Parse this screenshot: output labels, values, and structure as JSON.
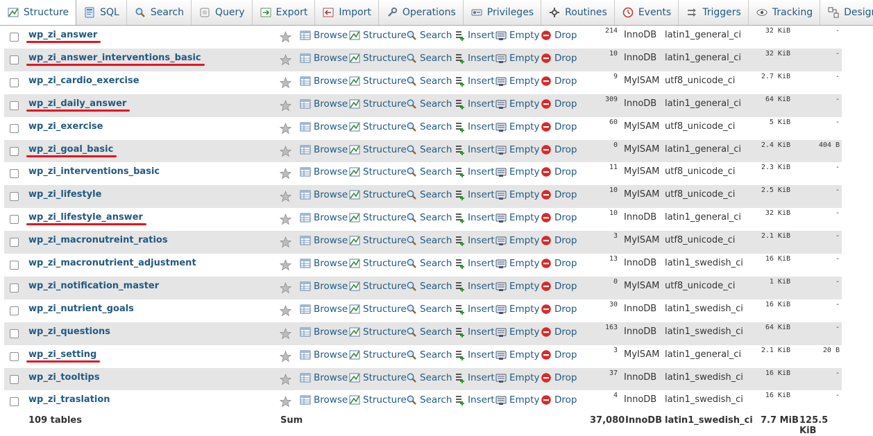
{
  "tabs": [
    {
      "label": "Structure",
      "icon": "structure-icon",
      "active": true
    },
    {
      "label": "SQL",
      "icon": "sql-icon",
      "active": false
    },
    {
      "label": "Search",
      "icon": "search-icon",
      "active": false
    },
    {
      "label": "Query",
      "icon": "query-icon",
      "active": false
    },
    {
      "label": "Export",
      "icon": "export-icon",
      "active": false
    },
    {
      "label": "Import",
      "icon": "import-icon",
      "active": false
    },
    {
      "label": "Operations",
      "icon": "wrench-icon",
      "active": false
    },
    {
      "label": "Privileges",
      "icon": "privileges-icon",
      "active": false
    },
    {
      "label": "Routines",
      "icon": "routines-icon",
      "active": false
    },
    {
      "label": "Events",
      "icon": "clock-icon",
      "active": false
    },
    {
      "label": "Triggers",
      "icon": "triggers-icon",
      "active": false
    },
    {
      "label": "Tracking",
      "icon": "eye-icon",
      "active": false
    },
    {
      "label": "Designer",
      "icon": "designer-icon",
      "active": false
    }
  ],
  "actions": {
    "browse": "Browse",
    "structure": "Structure",
    "search": "Search",
    "insert": "Insert",
    "empty": "Empty",
    "drop": "Drop"
  },
  "tables": [
    {
      "name": "wp_zi_answer",
      "rows": "214",
      "engine": "InnoDB",
      "collation": "latin1_general_ci",
      "size": "32 KiB",
      "overhead": "-",
      "underlined": true
    },
    {
      "name": "wp_zi_answer_interventions_basic",
      "rows": "10",
      "engine": "InnoDB",
      "collation": "latin1_general_ci",
      "size": "32 KiB",
      "overhead": "-",
      "underlined": true
    },
    {
      "name": "wp_zi_cardio_exercise",
      "rows": "9",
      "engine": "MyISAM",
      "collation": "utf8_unicode_ci",
      "size": "2.7 KiB",
      "overhead": "-",
      "underlined": false
    },
    {
      "name": "wp_zi_daily_answer",
      "rows": "309",
      "engine": "InnoDB",
      "collation": "latin1_general_ci",
      "size": "64 KiB",
      "overhead": "-",
      "underlined": true
    },
    {
      "name": "wp_zi_exercise",
      "rows": "60",
      "engine": "MyISAM",
      "collation": "utf8_unicode_ci",
      "size": "5 KiB",
      "overhead": "-",
      "underlined": false
    },
    {
      "name": "wp_zi_goal_basic",
      "rows": "0",
      "engine": "MyISAM",
      "collation": "latin1_general_ci",
      "size": "2.4 KiB",
      "overhead": "404 B",
      "underlined": true
    },
    {
      "name": "wp_zi_interventions_basic",
      "rows": "11",
      "engine": "MyISAM",
      "collation": "utf8_unicode_ci",
      "size": "2.3 KiB",
      "overhead": "-",
      "underlined": false
    },
    {
      "name": "wp_zi_lifestyle",
      "rows": "10",
      "engine": "MyISAM",
      "collation": "utf8_unicode_ci",
      "size": "2.5 KiB",
      "overhead": "-",
      "underlined": false
    },
    {
      "name": "wp_zi_lifestyle_answer",
      "rows": "10",
      "engine": "InnoDB",
      "collation": "latin1_general_ci",
      "size": "32 KiB",
      "overhead": "-",
      "underlined": true
    },
    {
      "name": "wp_zi_macronutreint_ratios",
      "rows": "3",
      "engine": "MyISAM",
      "collation": "utf8_unicode_ci",
      "size": "2.1 KiB",
      "overhead": "-",
      "underlined": false
    },
    {
      "name": "wp_zi_macronutrient_adjustment",
      "rows": "13",
      "engine": "InnoDB",
      "collation": "latin1_swedish_ci",
      "size": "16 KiB",
      "overhead": "-",
      "underlined": false
    },
    {
      "name": "wp_zi_notification_master",
      "rows": "0",
      "engine": "MyISAM",
      "collation": "utf8_unicode_ci",
      "size": "1 KiB",
      "overhead": "-",
      "underlined": false
    },
    {
      "name": "wp_zi_nutrient_goals",
      "rows": "30",
      "engine": "InnoDB",
      "collation": "latin1_swedish_ci",
      "size": "16 KiB",
      "overhead": "-",
      "underlined": false
    },
    {
      "name": "wp_zi_questions",
      "rows": "163",
      "engine": "InnoDB",
      "collation": "latin1_swedish_ci",
      "size": "64 KiB",
      "overhead": "-",
      "underlined": false
    },
    {
      "name": "wp_zi_setting",
      "rows": "3",
      "engine": "MyISAM",
      "collation": "latin1_general_ci",
      "size": "2.1 KiB",
      "overhead": "20 B",
      "underlined": true
    },
    {
      "name": "wp_zi_tooltips",
      "rows": "37",
      "engine": "InnoDB",
      "collation": "latin1_swedish_ci",
      "size": "16 KiB",
      "overhead": "-",
      "underlined": false
    },
    {
      "name": "wp_zi_traslation",
      "rows": "4",
      "engine": "InnoDB",
      "collation": "latin1_swedish_ci",
      "size": "16 KiB",
      "overhead": "-",
      "underlined": false
    }
  ],
  "footer": {
    "tables_count": "109 tables",
    "sum_label": "Sum",
    "total_rows": "37,080",
    "engine": "InnoDB",
    "collation": "latin1_swedish_ci",
    "total_size": "7.7 MiB",
    "total_overhead": "125.5 KiB"
  },
  "colors": {
    "link": "#235a81",
    "row_alt": "#e5e5e5",
    "underline": "#e8141f",
    "drop": "#d72a2a"
  }
}
